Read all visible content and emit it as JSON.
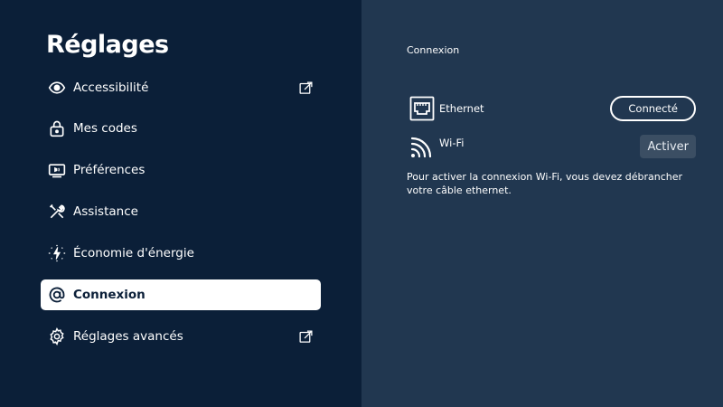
{
  "sidebar": {
    "title": "Réglages",
    "items": [
      {
        "label": "Accessibilité",
        "icon": "eye-icon",
        "external": true
      },
      {
        "label": "Mes codes",
        "icon": "lock-icon",
        "external": false
      },
      {
        "label": "Préférences",
        "icon": "tv-icon",
        "external": false
      },
      {
        "label": "Assistance",
        "icon": "tools-icon",
        "external": false
      },
      {
        "label": "Économie d'énergie",
        "icon": "energy-icon",
        "external": false
      },
      {
        "label": "Connexion",
        "icon": "at-icon",
        "external": false,
        "active": true
      },
      {
        "label": "Réglages avancés",
        "icon": "gear-icon",
        "external": true
      }
    ]
  },
  "main": {
    "section_title": "Connexion",
    "ethernet": {
      "label": "Ethernet",
      "status_button": "Connecté",
      "icon": "ethernet-port-icon"
    },
    "wifi": {
      "label": "Wi-Fi",
      "action_button": "Activer",
      "icon": "wifi-icon"
    },
    "info": "Pour activer la connexion Wi-Fi, vous devez débrancher votre câble ethernet."
  },
  "colors": {
    "sidebar_bg": "#0b1f38",
    "main_bg": "#213750",
    "active_item_bg": "#ffffff",
    "activate_button_bg": "#3b4e63"
  }
}
